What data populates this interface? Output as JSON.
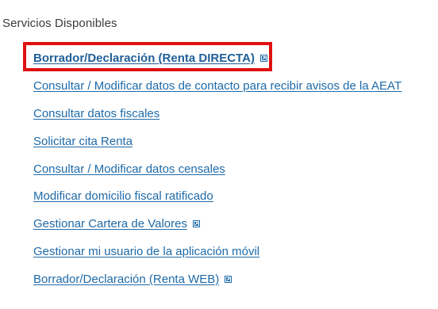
{
  "section": {
    "title": "Servicios Disponibles"
  },
  "services": [
    {
      "label": "Borrador/Declaración (Renta DIRECTA)",
      "external": true,
      "highlighted": true
    },
    {
      "label": "Consultar / Modificar datos de contacto para recibir avisos de la AEAT",
      "external": false
    },
    {
      "label": "Consultar datos fiscales",
      "external": false
    },
    {
      "label": "Solicitar cita Renta",
      "external": false
    },
    {
      "label": "Consultar / Modificar datos censales",
      "external": false
    },
    {
      "label": "Modificar domicilio fiscal ratificado",
      "external": false
    },
    {
      "label": "Gestionar Cartera de Valores",
      "external": true
    },
    {
      "label": "Gestionar mi usuario de la aplicación móvil",
      "external": false
    },
    {
      "label": "Borrador/Declaración (Renta WEB)",
      "external": true
    }
  ],
  "colors": {
    "link": "#1e6aa8",
    "highlight": "#e01010",
    "title": "#3a3a3a"
  },
  "icons": {
    "external": "external-link-icon"
  }
}
